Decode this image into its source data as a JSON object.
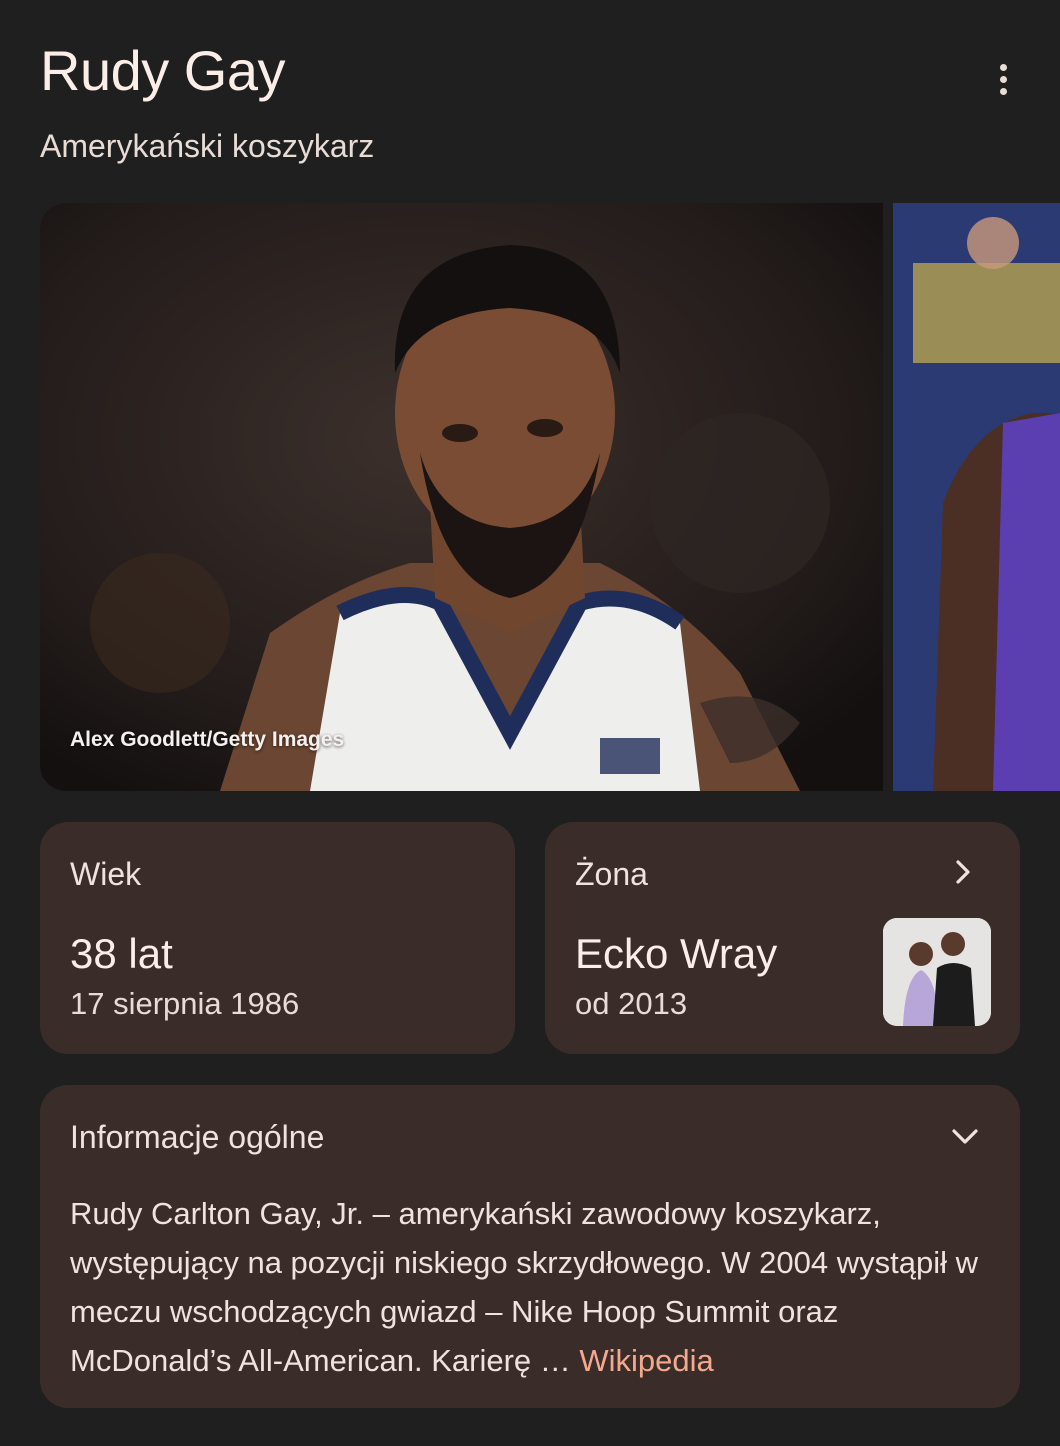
{
  "header": {
    "title": "Rudy Gay",
    "subtitle": "Amerykański koszykarz"
  },
  "images": {
    "main_credit": "Alex Goodlett/Getty Images"
  },
  "age_card": {
    "label": "Wiek",
    "value": "38 lat",
    "detail": "17 sierpnia 1986"
  },
  "spouse_card": {
    "label": "Żona",
    "value": "Ecko Wray",
    "detail": "od 2013"
  },
  "overview": {
    "title": "Informacje ogólne",
    "text": "Rudy Carlton Gay, Jr. – amerykański zawodowy koszykarz, występujący na pozycji niskiego skrzydłowego. W 2004 wystąpił w meczu wschodzących gwiazd – Nike Hoop Summit oraz McDonald’s All-American. Karierę",
    "ellipsis": " … ",
    "source_link": "Wikipedia"
  },
  "colors": {
    "background": "#1f1f1f",
    "card": "#3a2d29",
    "link": "#f4a98f"
  },
  "icons": [
    "more-vert-icon",
    "chevron-right-icon",
    "chevron-down-icon"
  ]
}
